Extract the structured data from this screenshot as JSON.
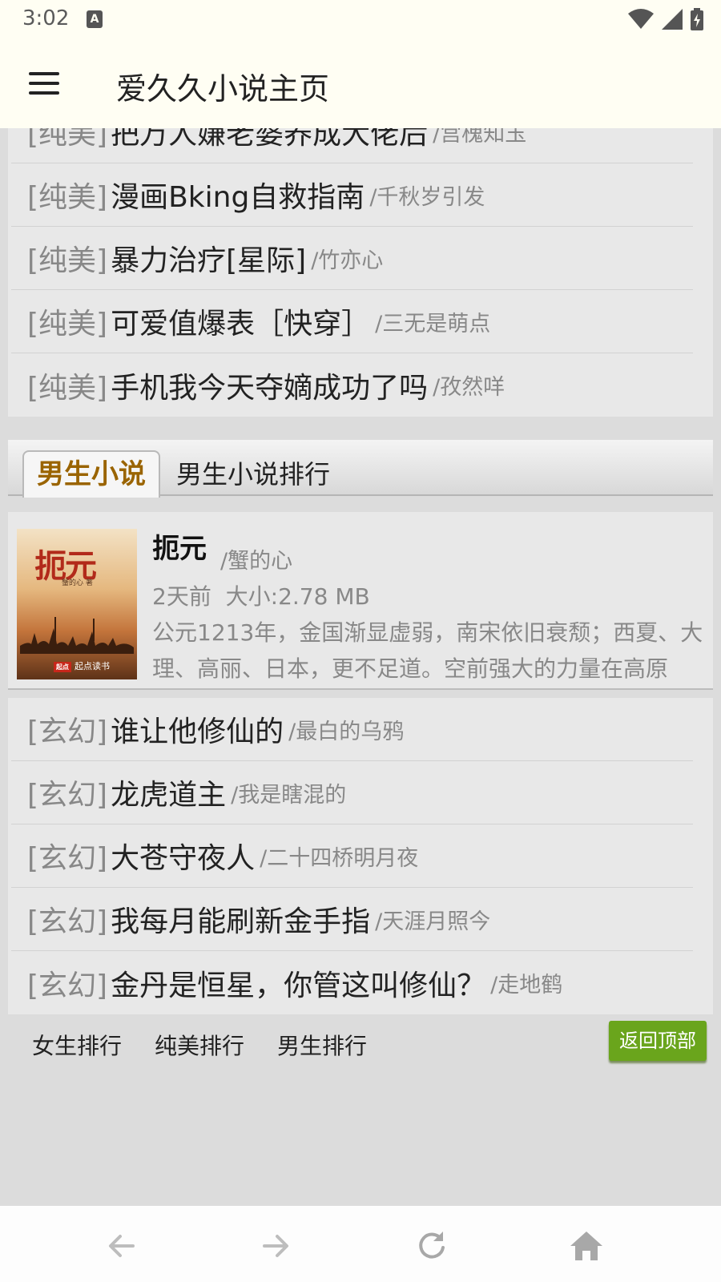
{
  "status_bar": {
    "time": "3:02",
    "notification_letter": "A"
  },
  "app_bar": {
    "title": "爱久久小说主页"
  },
  "top_list": [
    {
      "category": "[纯美]",
      "title": "把万人嫌老婆养成大佬后",
      "author": "/宫槐知玉"
    },
    {
      "category": "[纯美]",
      "title": "漫画Bking自救指南",
      "author": "/千秋岁引发"
    },
    {
      "category": "[纯美]",
      "title": "暴力治疗[星际]",
      "author": "/竹亦心"
    },
    {
      "category": "[纯美]",
      "title": "可爱值爆表［快穿］",
      "author": "/三无是萌点"
    },
    {
      "category": "[纯美]",
      "title": "手机我今天夺嫡成功了吗",
      "author": "/孜然咩"
    }
  ],
  "tabs": {
    "active": "男生小说",
    "other": "男生小说排行"
  },
  "featured_book": {
    "cover_title": "扼元",
    "cover_author_line": "蟹的心 著",
    "cover_publisher": "起点读书",
    "cover_publisher_badge": "起点",
    "title": "扼元",
    "author": "/蟹的心",
    "updated": "2天前",
    "size": "大小:2.78 MB",
    "description": "公元1213年，金国渐显虚弱，南宋依旧衰颓；西夏、大理、高丽、日本，更不足道。空前强大的力量在高原"
  },
  "bottom_list": [
    {
      "category": "[玄幻]",
      "title": "谁让他修仙的",
      "author": "/最白的乌鸦"
    },
    {
      "category": "[玄幻]",
      "title": "龙虎道主",
      "author": "/我是瞎混的"
    },
    {
      "category": "[玄幻]",
      "title": "大苍守夜人",
      "author": "/二十四桥明月夜"
    },
    {
      "category": "[玄幻]",
      "title": "我每月能刷新金手指",
      "author": "/天涯月照今"
    },
    {
      "category": "[玄幻]",
      "title": "金丹是恒星，你管这叫修仙？",
      "author": "/走地鹤"
    }
  ],
  "footer_links": {
    "female_rank": "女生排行",
    "pure_rank": "纯美排行",
    "male_rank": "男生排行",
    "back_to_top": "返回顶部"
  },
  "nav_icons": [
    "back-arrow-icon",
    "forward-arrow-icon",
    "refresh-icon",
    "home-icon"
  ],
  "colors": {
    "accent_green": "#6aa51c",
    "tab_active_text": "#9a6400",
    "app_bar_bg": "#fffef3"
  }
}
